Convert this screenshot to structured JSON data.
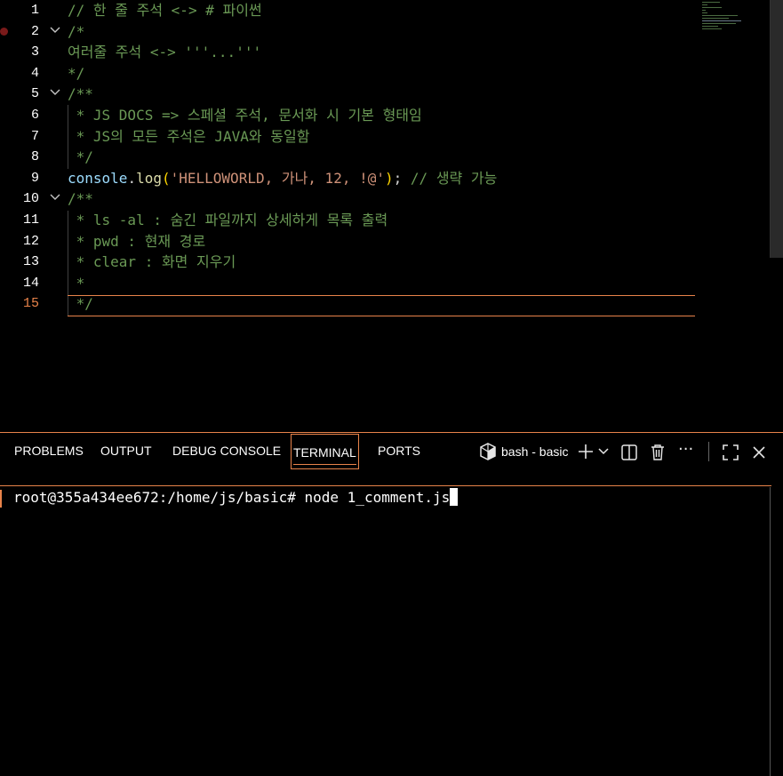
{
  "editor": {
    "lines": [
      {
        "num": "1",
        "text": "// 한 줄 주석 <-> # 파이썬"
      },
      {
        "num": "2",
        "text": "/*"
      },
      {
        "num": "3",
        "text": "여러줄 주석 <-> '''...'''"
      },
      {
        "num": "4",
        "text": "*/"
      },
      {
        "num": "5",
        "text": "/**"
      },
      {
        "num": "6",
        "text": " * JS DOCS => 스페셜 주석, 문서화 시 기본 형태임"
      },
      {
        "num": "7",
        "text": " * JS의 모든 주석은 JAVA와 동일함"
      },
      {
        "num": "8",
        "text": " */"
      },
      {
        "num": "9",
        "code": {
          "obj": "console",
          "dot": ".",
          "fn": "log",
          "open": "(",
          "str": "'HELLOWORLD, 가나, 12, !@'",
          "close": ")",
          "semi": ";",
          "comment": " // 생략 가능"
        }
      },
      {
        "num": "10",
        "text": "/**"
      },
      {
        "num": "11",
        "text": " * ls -al : 숨긴 파일까지 상세하게 목록 출력"
      },
      {
        "num": "12",
        "text": " * pwd : 현재 경로"
      },
      {
        "num": "13",
        "text": " * clear : 화면 지우기"
      },
      {
        "num": "14",
        "text": " *"
      },
      {
        "num": "15",
        "text": " */"
      }
    ],
    "active_line": "15",
    "fold_icon": "chevron-down-icon"
  },
  "panel": {
    "tabs": [
      {
        "label": "PROBLEMS"
      },
      {
        "label": "OUTPUT"
      },
      {
        "label": "DEBUG CONSOLE"
      },
      {
        "label": "TERMINAL"
      },
      {
        "label": "PORTS"
      }
    ],
    "active_tab": "TERMINAL",
    "terminal_name": "bash - basic",
    "icons": {
      "terminal": "terminal-icon",
      "add": "plus-icon",
      "dropdown": "chevron-down-icon",
      "split": "split-terminal-icon",
      "delete": "trash-icon",
      "more": "ellipsis-icon",
      "maximize": "maximize-icon",
      "close": "close-icon"
    }
  },
  "terminal": {
    "prompt": "root@355a434ee672:/home/js/basic# ",
    "command": "node 1_comment.js"
  },
  "colors": {
    "accent": "#e8834a",
    "comment": "#6a9955",
    "string": "#ce9178",
    "function": "#dcdcaa",
    "variable": "#9cdcfe"
  }
}
